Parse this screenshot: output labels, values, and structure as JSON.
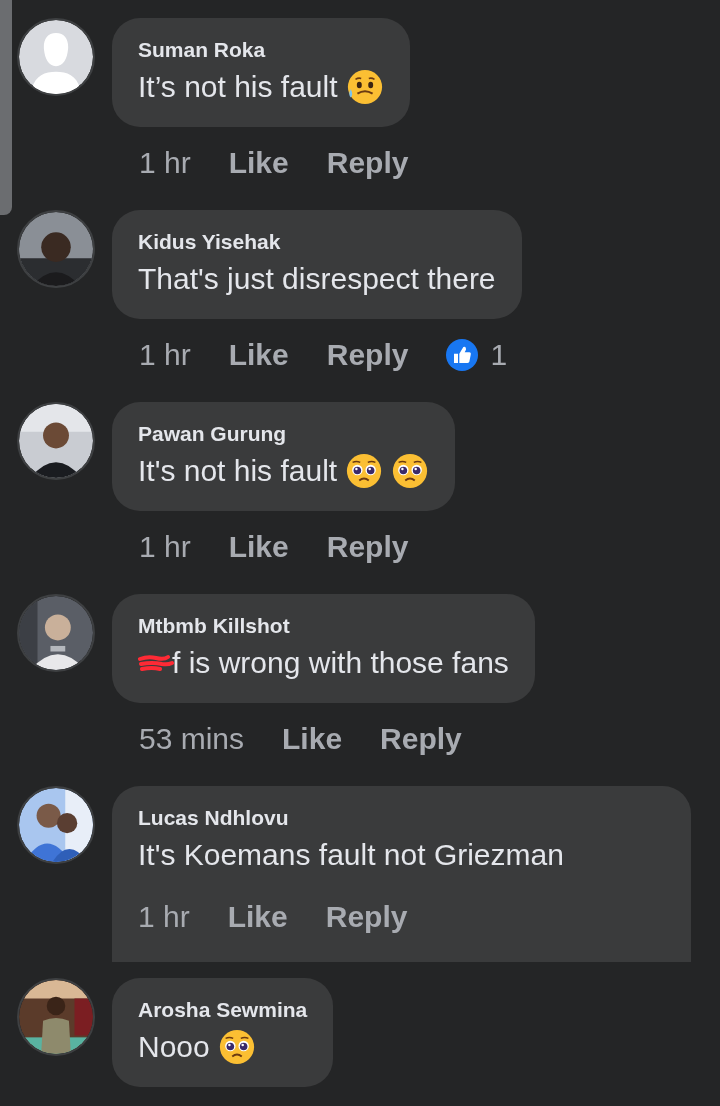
{
  "comments": [
    {
      "author": "Suman Roka",
      "avatar": {
        "kind": "default"
      },
      "text": "It’s not his fault",
      "emojis": [
        {
          "kind": "sweat"
        }
      ],
      "redacted": false,
      "highlighted": false,
      "time": "1 hr",
      "like": "Like",
      "reply": "Reply"
    },
    {
      "author": "Kidus Yisehak",
      "avatar": {
        "kind": "picture"
      },
      "text": "That's just disrespect there",
      "redacted": false,
      "highlighted": false,
      "time": "1 hr",
      "like": "Like",
      "reply": "Reply",
      "reactions": "1"
    },
    {
      "author": "Pawan Gurung",
      "avatar": {
        "kind": "picture"
      },
      "text": "It's not his fault",
      "emojis": [
        {
          "kind": "pleading"
        },
        {
          "kind": "pleading"
        }
      ],
      "redacted": false,
      "highlighted": false,
      "time": "1 hr",
      "like": "Like",
      "reply": "Reply"
    },
    {
      "author": "Mtbmb Killshot",
      "avatar": {
        "kind": "picture"
      },
      "text": "f is wrong with those fans",
      "redacted": true,
      "highlighted": false,
      "time": "53 mins",
      "like": "Like",
      "reply": "Reply"
    },
    {
      "author": "Lucas Ndhlovu",
      "avatar": {
        "kind": "picture"
      },
      "text": "It's Koemans fault not Griezman",
      "redacted": false,
      "highlighted": true,
      "time": "1 hr",
      "like": "Like",
      "reply": "Reply"
    },
    {
      "author": "Arosha Sewmina",
      "avatar": {
        "kind": "picture"
      },
      "text": "Nooo",
      "emojis": [
        {
          "kind": "pleading"
        }
      ],
      "redacted": false,
      "highlighted": false
    }
  ]
}
